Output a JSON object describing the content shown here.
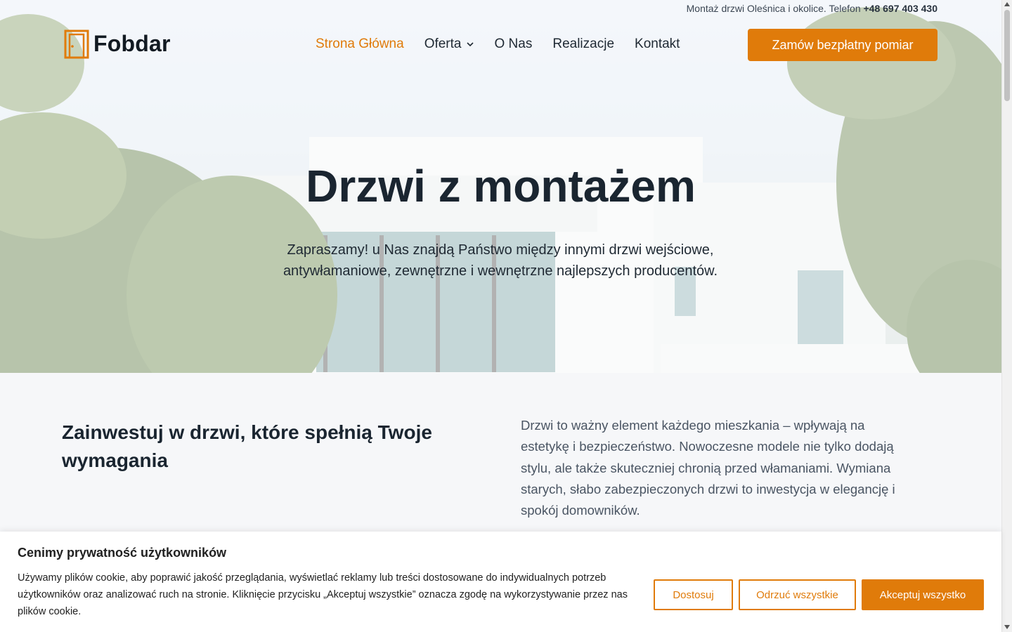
{
  "topbar": {
    "text": "Montaż drzwi Oleśnica i okolice. Telefon ",
    "phone": "+48 697 403 430"
  },
  "brand": {
    "name": "Fobdar",
    "icon": "door-logo-icon"
  },
  "nav": {
    "items": [
      {
        "label": "Strona Główna",
        "active": true
      },
      {
        "label": "Oferta",
        "has_dropdown": true
      },
      {
        "label": "O Nas"
      },
      {
        "label": "Realizacje"
      },
      {
        "label": "Kontakt"
      }
    ],
    "cta": "Zamów bezpłatny pomiar"
  },
  "hero": {
    "title": "Drzwi z montażem",
    "subtitle": "Zapraszamy! u Nas znajdą Państwo między innymi drzwi wejściowe, antywłamaniowe, zewnętrzne i wewnętrzne najlepszych producentów."
  },
  "intro": {
    "heading": "Zainwestuj w drzwi, które spełnią Twoje wymagania",
    "body": "Drzwi to ważny element każdego mieszkania – wpływają na estetykę i bezpieczeństwo. Nowoczesne modele nie tylko dodają stylu, ale także skuteczniej chronią przed włamaniami. Wymiana starych, słabo zabezpieczonych drzwi to inwestycja w elegancję i spokój domowników."
  },
  "cookie": {
    "title": "Cenimy prywatność użytkowników",
    "text": "Używamy plików cookie, aby poprawić jakość przeglądania, wyświetlać reklamy lub treści dostosowane do indywidualnych potrzeb użytkowników oraz analizować ruch na stronie. Kliknięcie przycisku „Akceptuj wszystkie” oznacza zgodę na wykorzystywanie przez nas plików cookie.",
    "customize": "Dostosuj",
    "reject": "Odrzuć wszystkie",
    "accept": "Akceptuj wszystko"
  },
  "colors": {
    "accent": "#e07b0a",
    "heading": "#1a2530",
    "body_text": "#4a5563"
  }
}
